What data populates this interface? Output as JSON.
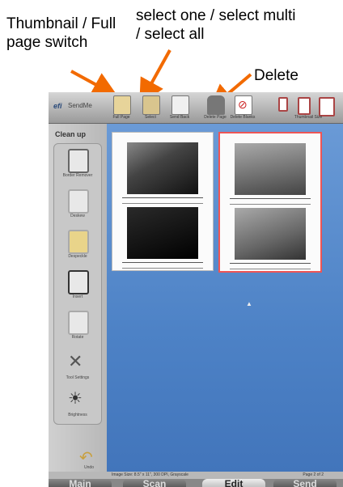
{
  "annotations": {
    "thumbnail_switch": "Thumbnail / Full page switch",
    "select_modes": "select one / select multi / select all",
    "delete": "Delete"
  },
  "app": {
    "brand": "efi",
    "name": "SendMe"
  },
  "toolbar": {
    "buttons": [
      {
        "label": "Full Page",
        "icon": "page-view-icon"
      },
      {
        "label": "Select",
        "icon": "select-icon"
      },
      {
        "label": "Send Back",
        "icon": "page-icon"
      },
      {
        "label": "Delete Page",
        "icon": "trash-icon"
      },
      {
        "label": "Delete Blanks",
        "icon": "no-icon"
      },
      {
        "label": "Thumbnail Size",
        "icon": "thumbnail-size-icon"
      }
    ]
  },
  "sidebar": {
    "title": "Clean up",
    "items": [
      {
        "label": "Border Remover",
        "icon": "page-icon"
      },
      {
        "label": "Deskew",
        "icon": "deskew-icon"
      },
      {
        "label": "Despeckle",
        "icon": "eraser-icon"
      },
      {
        "label": "Insert",
        "icon": "insert-icon"
      },
      {
        "label": "Rotate",
        "icon": "rotate-icon"
      },
      {
        "label": "Tool Settings",
        "icon": "tools-icon"
      },
      {
        "label": "Brightness",
        "icon": "brightness-icon"
      }
    ],
    "undo_label": "Undo"
  },
  "status": {
    "left": "Image Size: 8.5\" x 11\", 300 DPI, Grayscale",
    "right": "Page 2 of 2"
  },
  "tabs": [
    {
      "label": "Main"
    },
    {
      "label": "Scan"
    },
    {
      "label": "Edit"
    },
    {
      "label": "Send"
    }
  ],
  "colors": {
    "canvas": "#4d82c6",
    "selection": "#e55555",
    "arrow": "#f26a00"
  }
}
